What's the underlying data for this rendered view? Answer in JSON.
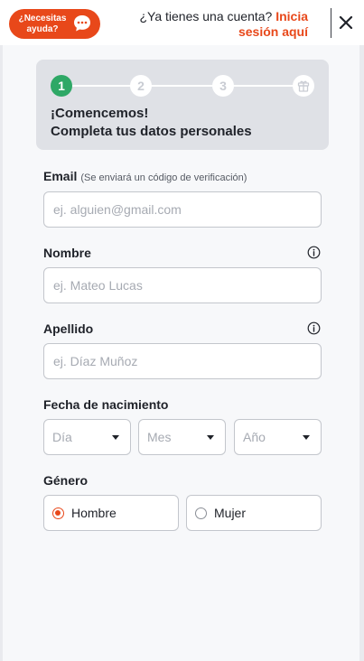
{
  "header": {
    "help_label": "¿Necesitas ayuda?",
    "account_question": "¿Ya tienes una cuenta?",
    "login_link": "Inicia sesión aquí",
    "close_icon": "close-icon",
    "chat_icon": "chat-bubble-icon"
  },
  "stepper": {
    "steps": [
      "1",
      "2",
      "3"
    ],
    "final_step_icon": "gift-icon",
    "active_step": 1,
    "title_line1": "¡Comencemos!",
    "title_line2": "Completa tus datos personales"
  },
  "form": {
    "email": {
      "label": "Email",
      "hint": "(Se enviará un código de verificación)",
      "placeholder": "ej. alguien@gmail.com",
      "value": ""
    },
    "first_name": {
      "label": "Nombre",
      "placeholder": "ej. Mateo Lucas",
      "value": ""
    },
    "last_name": {
      "label": "Apellido",
      "placeholder": "ej. Díaz Muñoz",
      "value": ""
    },
    "birthdate": {
      "label": "Fecha de nacimiento",
      "day": "Día",
      "month": "Mes",
      "year": "Año"
    },
    "gender": {
      "label": "Género",
      "options": [
        "Hombre",
        "Mujer"
      ],
      "selected": "Hombre"
    }
  },
  "colors": {
    "accent": "#e8481a",
    "active_step": "#2ea866",
    "stepper_bg": "#dfe1e6"
  }
}
